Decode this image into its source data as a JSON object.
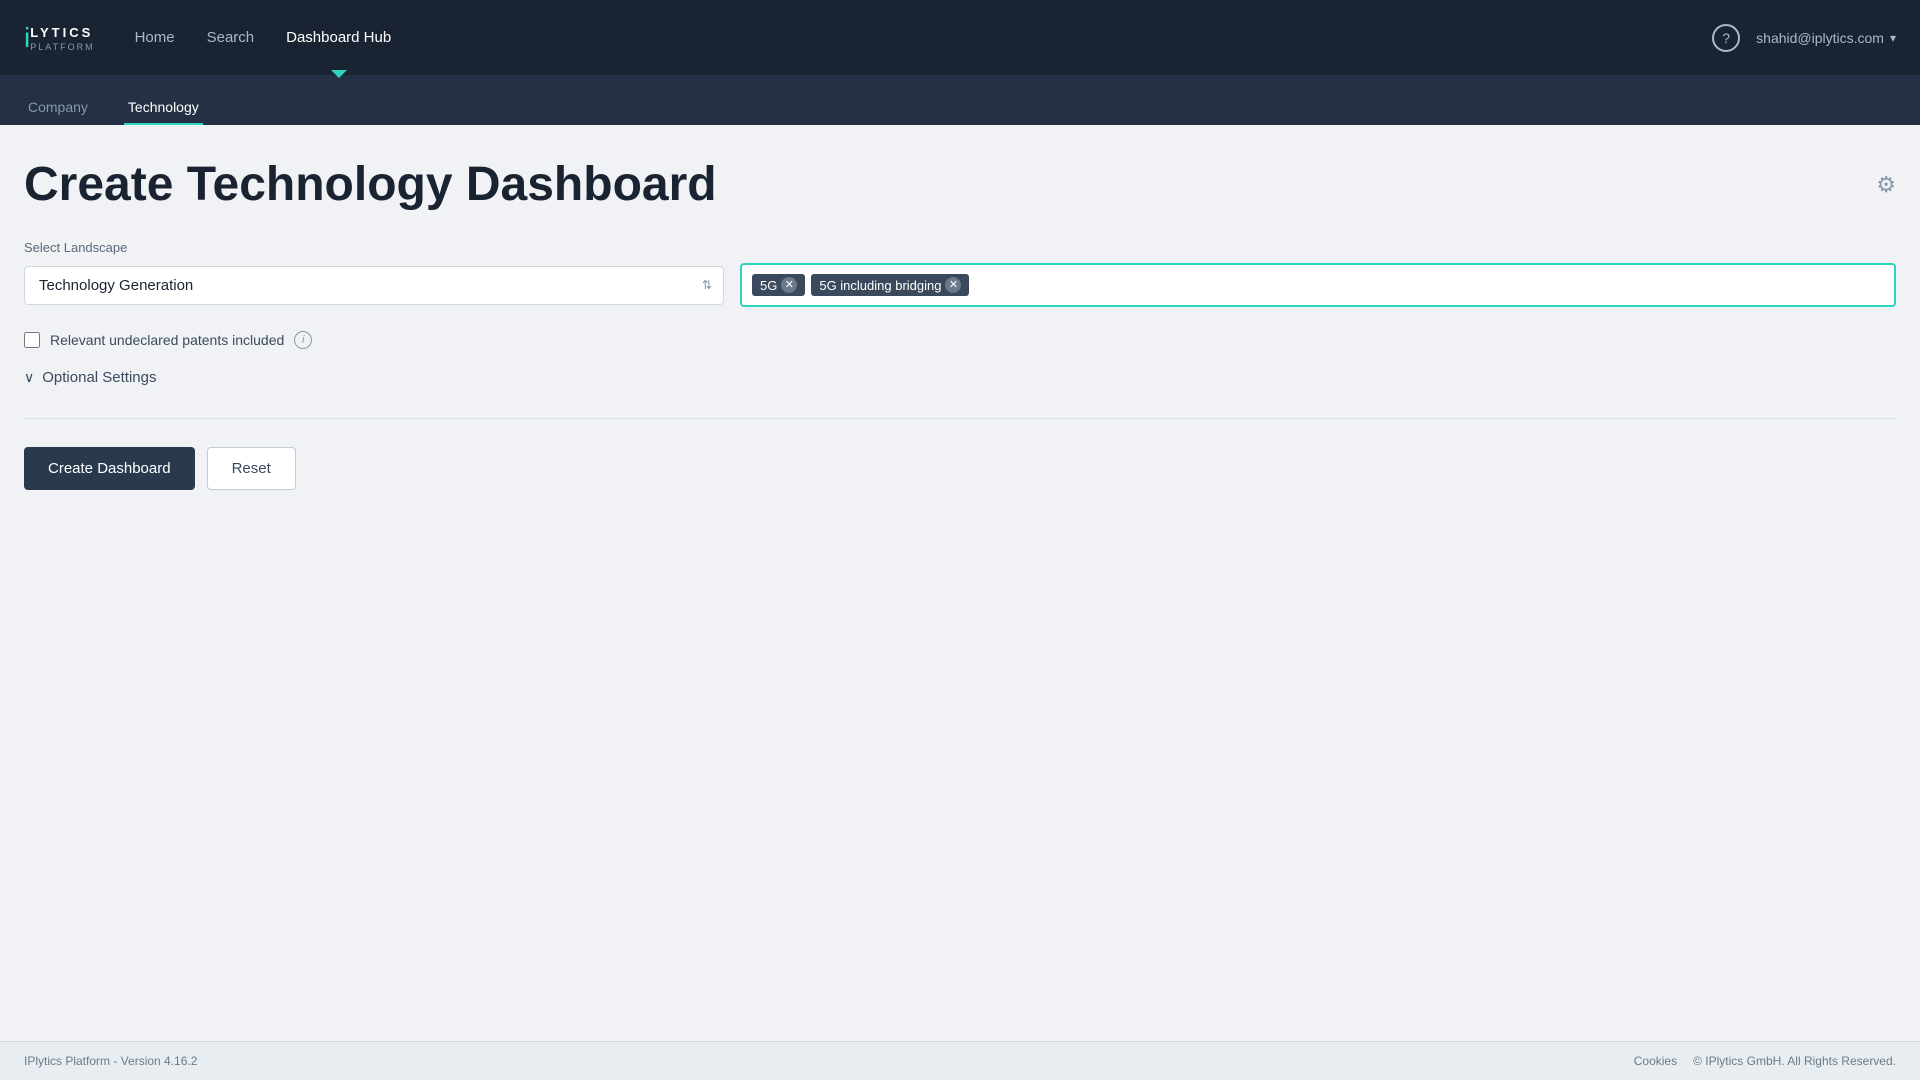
{
  "app": {
    "logo_text": "LYTICS",
    "logo_sub": "PLATFORM"
  },
  "nav": {
    "links": [
      {
        "label": "Home",
        "active": false
      },
      {
        "label": "Search",
        "active": false
      },
      {
        "label": "Dashboard Hub",
        "active": true
      }
    ],
    "user_email": "shahid@iplytics.com",
    "help_label": "?"
  },
  "sub_nav": {
    "items": [
      {
        "label": "Company",
        "active": false
      },
      {
        "label": "Technology",
        "active": true
      }
    ]
  },
  "page": {
    "title": "Create Technology Dashboard",
    "select_landscape_label": "Select Landscape",
    "landscape_value": "Technology Generation",
    "tags": [
      {
        "label": "5G"
      },
      {
        "label": "5G including bridging"
      }
    ],
    "checkbox_label": "Relevant undeclared patents included",
    "optional_settings_label": "Optional Settings",
    "create_btn_label": "Create Dashboard",
    "reset_btn_label": "Reset"
  },
  "footer": {
    "version": "IPlytics Platform - Version 4.16.2",
    "cookies_label": "Cookies",
    "copyright": "© IPlytics GmbH. All Rights Reserved."
  }
}
